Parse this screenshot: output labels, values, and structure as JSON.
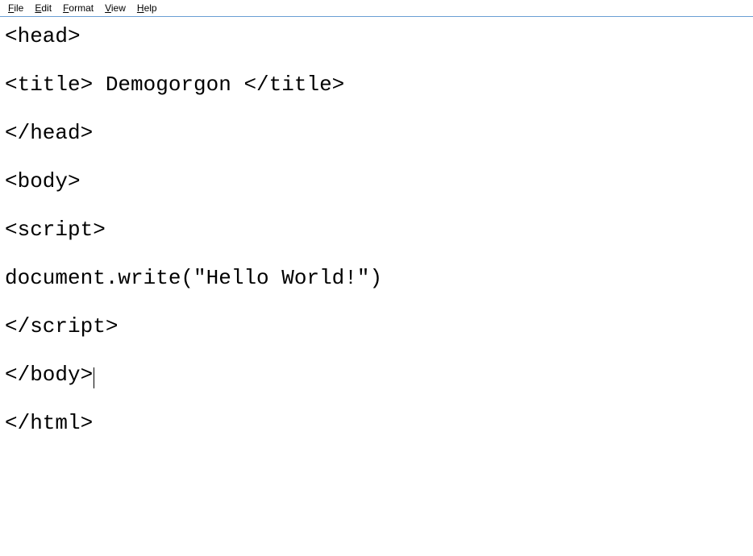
{
  "menubar": {
    "items": [
      {
        "accel": "F",
        "rest": "ile"
      },
      {
        "accel": "E",
        "rest": "dit"
      },
      {
        "accel": "F",
        "rest": "ormat"
      },
      {
        "accel": "V",
        "rest": "iew"
      },
      {
        "accel": "H",
        "rest": "elp"
      }
    ]
  },
  "editor": {
    "lines": [
      "<head>",
      "",
      "<title> Demogorgon </title>",
      "",
      "</head>",
      "",
      "<body>",
      "",
      "<script>",
      "",
      "document.write(\"Hello World!\")",
      "",
      "</script>",
      "",
      "</body>",
      "",
      "</html>"
    ],
    "caret_line_index": 14
  }
}
